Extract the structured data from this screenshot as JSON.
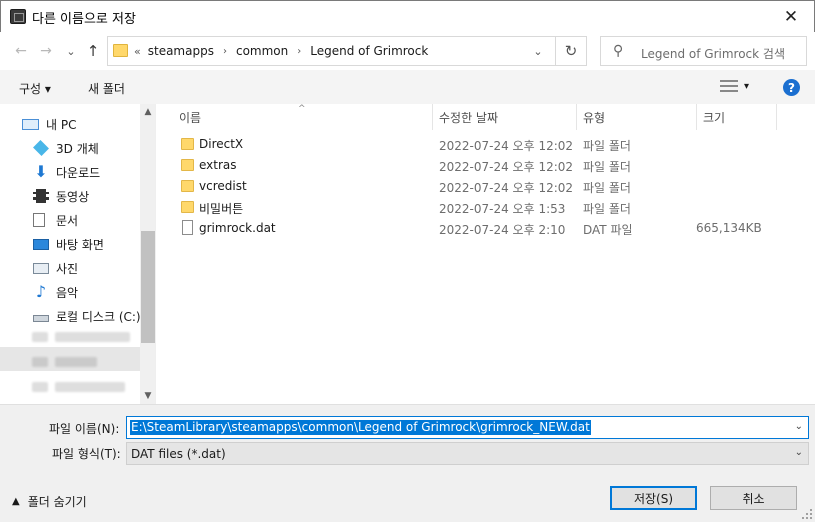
{
  "window": {
    "title": "다른 이름으로 저장",
    "close_glyph": "✕"
  },
  "nav": {
    "back_glyph": "←",
    "forward_glyph": "→",
    "recent_glyph": "⌄",
    "up_glyph": "↑",
    "overflow_glyph": "«",
    "crumbs": [
      "steamapps",
      "common",
      "Legend of Grimrock"
    ],
    "search_placeholder": "Legend of Grimrock 검색",
    "refresh_glyph": "↻",
    "dropdown_glyph": "⌄"
  },
  "toolbar": {
    "organize": "구성 ▾",
    "new_folder": "새 폴더",
    "view_dropdown": "▾",
    "help": "?"
  },
  "sidebar": {
    "items": [
      {
        "label": "내 PC",
        "icon": "pc-icon"
      },
      {
        "label": "3D 개체",
        "icon": "3d-objects-icon"
      },
      {
        "label": "다운로드",
        "icon": "download-icon"
      },
      {
        "label": "동영상",
        "icon": "video-icon"
      },
      {
        "label": "문서",
        "icon": "document-icon"
      },
      {
        "label": "바탕 화면",
        "icon": "desktop-icon"
      },
      {
        "label": "사진",
        "icon": "picture-icon"
      },
      {
        "label": "음악",
        "icon": "music-icon"
      },
      {
        "label": "로컬 디스크 (C:)",
        "icon": "drive-icon"
      }
    ]
  },
  "columns": {
    "name": "이름",
    "date": "수정한 날짜",
    "type": "유형",
    "size": "크기"
  },
  "files": [
    {
      "name": "DirectX",
      "date": "2022-07-24 오후 12:02",
      "type": "파일 폴더",
      "size": "",
      "kind": "folder"
    },
    {
      "name": "extras",
      "date": "2022-07-24 오후 12:02",
      "type": "파일 폴더",
      "size": "",
      "kind": "folder"
    },
    {
      "name": "vcredist",
      "date": "2022-07-24 오후 12:02",
      "type": "파일 폴더",
      "size": "",
      "kind": "folder"
    },
    {
      "name": "비밀버튼",
      "date": "2022-07-24 오후 1:53",
      "type": "파일 폴더",
      "size": "",
      "kind": "folder"
    },
    {
      "name": "grimrock.dat",
      "date": "2022-07-24 오후 2:10",
      "type": "DAT 파일",
      "size": "665,134KB",
      "kind": "file"
    }
  ],
  "save": {
    "filename_label": "파일 이름(N):",
    "filename_value": "E:\\SteamLibrary\\steamapps\\common\\Legend of Grimrock\\grimrock_NEW.dat",
    "filetype_label": "파일 형식(T):",
    "filetype_value": "DAT files (*.dat)",
    "hide_folders": "폴더 숨기기",
    "save_button": "저장(S)",
    "cancel_button": "취소"
  }
}
